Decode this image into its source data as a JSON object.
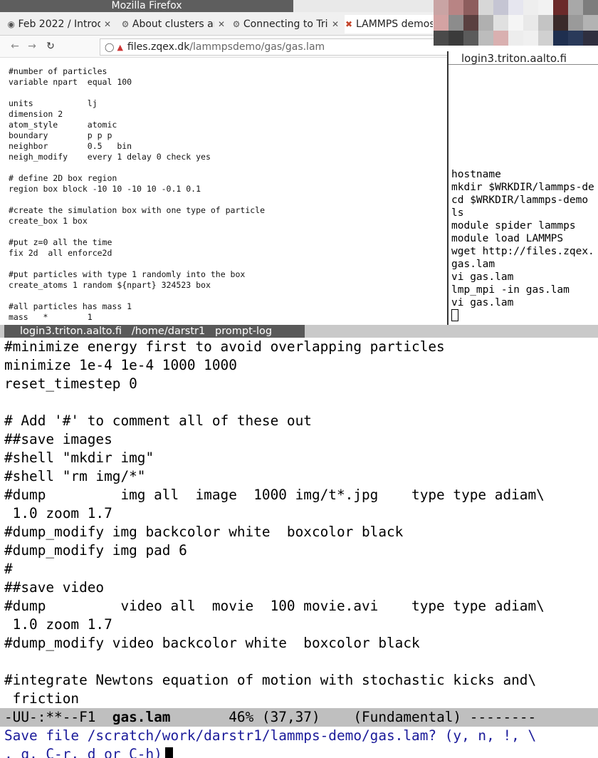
{
  "firefox": {
    "title": "Mozilla Firefox",
    "tabs": [
      {
        "label": "Feb 2022 / Introd",
        "icon": "gitlab-icon"
      },
      {
        "label": "About clusters ar",
        "icon": "person-icon"
      },
      {
        "label": "Connecting to Tri",
        "icon": "person-icon"
      },
      {
        "label": "LAMMPS demos",
        "icon": "tools-icon"
      }
    ],
    "url_domain": "files.zqex.dk",
    "url_path": "/lammpsdemo/gas/gas.lam",
    "content_lines": [
      "#number of particles",
      "variable npart  equal 100",
      "",
      "units           lj",
      "dimension 2",
      "atom_style      atomic",
      "boundary        p p p",
      "neighbor        0.5   bin",
      "neigh_modify    every 1 delay 0 check yes",
      "",
      "# define 2D box region",
      "region box block -10 10 -10 10 -0.1 0.1",
      "",
      "#create the simulation box with one type of particle",
      "create_box 1 box",
      "",
      "#put z=0 all the time",
      "fix 2d  all enforce2d",
      "",
      "#put particles with type 1 randomly into the box",
      "create_atoms 1 random ${npart} 324523 box",
      "",
      "#all particles has mass 1",
      "mass   *        1"
    ]
  },
  "xterm_small": {
    "title": "login3.triton.aalto.fi",
    "lines": [
      "hostname",
      "mkdir $WRKDIR/lammps-de",
      "cd $WRKDIR/lammps-demo",
      "ls",
      "module spider lammps",
      "module load LAMMPS",
      "wget http://files.zqex.",
      "gas.lam",
      "vi gas.lam",
      "lmp_mpi -in gas.lam",
      "vi gas.lam"
    ]
  },
  "xterm_status": "login3.triton.aalto.fi   /home/darstr1   prompt-log",
  "emacs": {
    "lines": [
      "#minimize energy first to avoid overlapping particles",
      "minimize 1e-4 1e-4 1000 1000",
      "reset_timestep 0",
      "",
      "# Add '#' to comment all of these out",
      "##save images",
      "#shell \"mkdir img\"",
      "#shell \"rm img/*\"",
      "#dump         img all  image  1000 img/t*.jpg    type type adiam\\",
      " 1.0 zoom 1.7",
      "#dump_modify img backcolor white  boxcolor black",
      "#dump_modify img pad 6",
      "#",
      "##save video",
      "#dump         video all  movie  100 movie.avi    type type adiam\\",
      " 1.0 zoom 1.7",
      "#dump_modify video backcolor white  boxcolor black",
      "",
      "#integrate Newtons equation of motion with stochastic kicks and\\",
      " friction"
    ],
    "modeline_prefix": "-UU-:**--F1  ",
    "modeline_buffer": "gas.lam",
    "modeline_suffix": "       46% (37,37)    (Fundamental) --------",
    "minibuffer_line1": "Save file /scratch/work/darstr1/lammps-demo/gas.lam? (y, n, !, \\",
    "minibuffer_line2": ", q, C-r, d or C-h)"
  }
}
